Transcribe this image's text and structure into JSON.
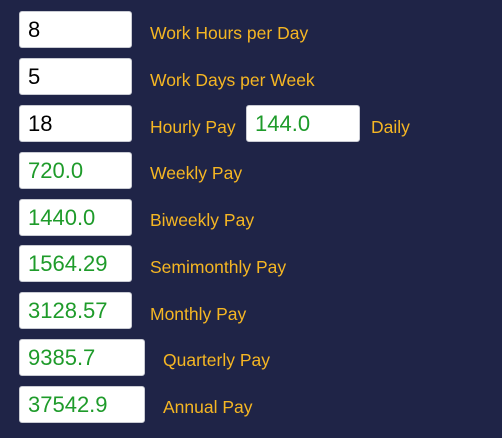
{
  "colors": {
    "background": "#1f2447",
    "label": "#f5b623",
    "input_text": "#000000",
    "output_text": "#1e9b2a",
    "field_bg": "#ffffff"
  },
  "inputs": {
    "work_hours_per_day": {
      "value": "8",
      "label": "Work Hours per Day"
    },
    "work_days_per_week": {
      "value": "5",
      "label": "Work Days per Week"
    },
    "hourly_pay": {
      "value": "18",
      "label": "Hourly Pay"
    }
  },
  "outputs": {
    "daily": {
      "value": "144.0",
      "label": "Daily"
    },
    "weekly": {
      "value": "720.0",
      "label": "Weekly Pay"
    },
    "biweekly": {
      "value": "1440.0",
      "label": "Biweekly Pay"
    },
    "semimonthly": {
      "value": "1564.29",
      "label": "Semimonthly Pay"
    },
    "monthly": {
      "value": "3128.57",
      "label": "Monthly Pay"
    },
    "quarterly": {
      "value": "9385.7",
      "label": "Quarterly Pay"
    },
    "annual": {
      "value": "37542.9",
      "label": "Annual Pay"
    }
  }
}
